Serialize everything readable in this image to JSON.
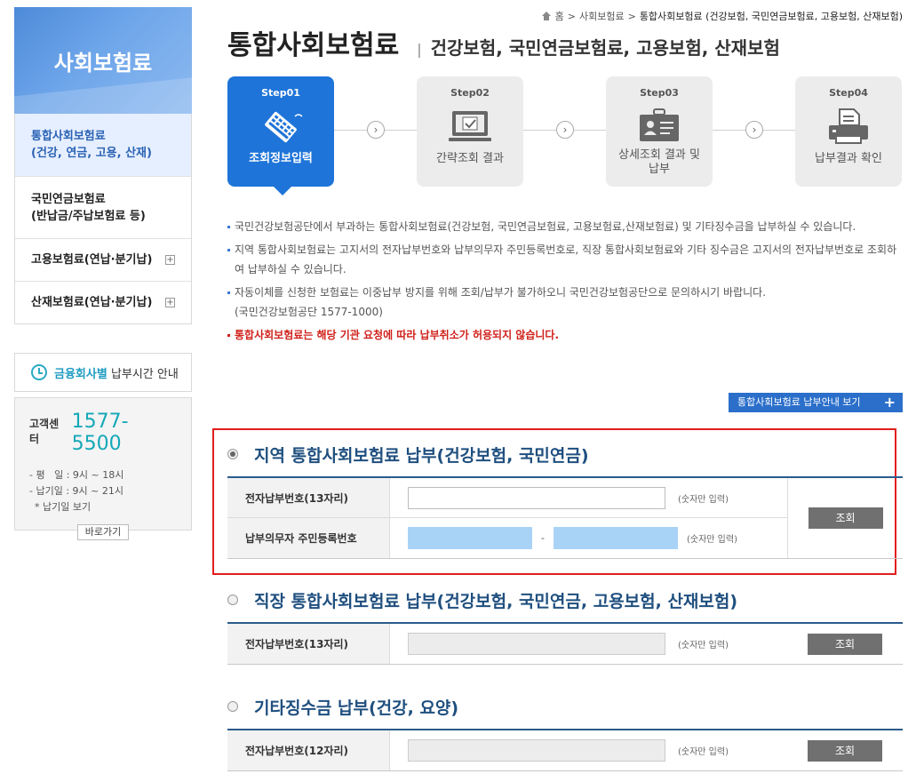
{
  "sidebar": {
    "hero_title": "사회보험료",
    "items": [
      {
        "line1": "통합사회보험료",
        "line2": "(건강, 연금, 고용, 산재)"
      },
      {
        "line1": "국민연금보험료",
        "line2": "(반납금/주납보험료 등)"
      },
      {
        "line1": "고용보험료(연납·분기납)"
      },
      {
        "line1": "산재보험료(연납·분기납)"
      }
    ],
    "plus_symbol": "+",
    "time_box": {
      "strong": "금융회사별",
      "rest": " 납부시간 안내"
    },
    "cs": {
      "label": "고객센터",
      "phone": "1577-5500",
      "line1": "- 평   일 : 9시 ~ 18시",
      "line2": "- 납기일 : 9시 ~ 21시",
      "line3": "* 납기일 보기",
      "button": "바로가기"
    }
  },
  "breadcrumb": {
    "home": "홈",
    "sep": ">",
    "level1": "사회보험료",
    "current": "통합사회보험료 (건강보험, 국민연금보험료, 고용보험, 산재보험)"
  },
  "header": {
    "title": "통합사회보험료",
    "subtitle": "건강보험, 국민연금보험료, 고용보험, 산재보험"
  },
  "steps": [
    {
      "no": "Step01",
      "label": "조회정보입력",
      "active": true
    },
    {
      "no": "Step02",
      "label": "간략조회 결과"
    },
    {
      "no": "Step03",
      "label": "상세조회 결과 및 납부"
    },
    {
      "no": "Step04",
      "label": "납부결과 확인"
    }
  ],
  "notes": {
    "n1": "국민건강보험공단에서 부과하는 통합사회보험료(건강보험, 국민연금보험료, 고용보험료,산재보험료) 및 기타징수금을 납부하실 수 있습니다.",
    "n2": "지역 통합사회보험료는 고지서의 전자납부번호와 납부의무자 주민등록번호로, 직장 통합사회보험료와 기타 징수금은 고지서의 전자납부번호로 조회하여 납부하실 수 있습니다.",
    "n3": "자동이체를 신청한 보험료는 이중납부 방지를 위해 조회/납부가 불가하오니 국민건강보험공단으로 문의하시기 바랍니다.",
    "n3_sub": "(국민건강보험공단 1577-1000)",
    "n4": "통합사회보험료는 해당 기관 요청에 따라 납부취소가 허용되지 않습니다."
  },
  "guide_button": {
    "label": "통합사회보험료 납부안내 보기",
    "plus": "+"
  },
  "section1": {
    "title": "지역 통합사회보험료 납부(건강보험, 국민연금)",
    "row1_label": "전자납부번호(13자리)",
    "row2_label": "납부의무자 주민등록번호",
    "hint": "(숫자만 입력)",
    "dash": "-",
    "button": "조회"
  },
  "section2": {
    "title": "직장 통합사회보험료 납부(건강보험, 국민연금, 고용보험, 산재보험)",
    "row1_label": "전자납부번호(13자리)",
    "hint": "(숫자만 입력)",
    "button": "조회"
  },
  "section3": {
    "title": "기타징수금 납부(건강, 요양)",
    "row1_label": "전자납부번호(12자리)",
    "hint": "(숫자만 입력)",
    "button": "조회"
  },
  "colors": {
    "accent": "#1e74d8",
    "highlight": "#e21c1c",
    "section_title": "#1f4f7f"
  }
}
